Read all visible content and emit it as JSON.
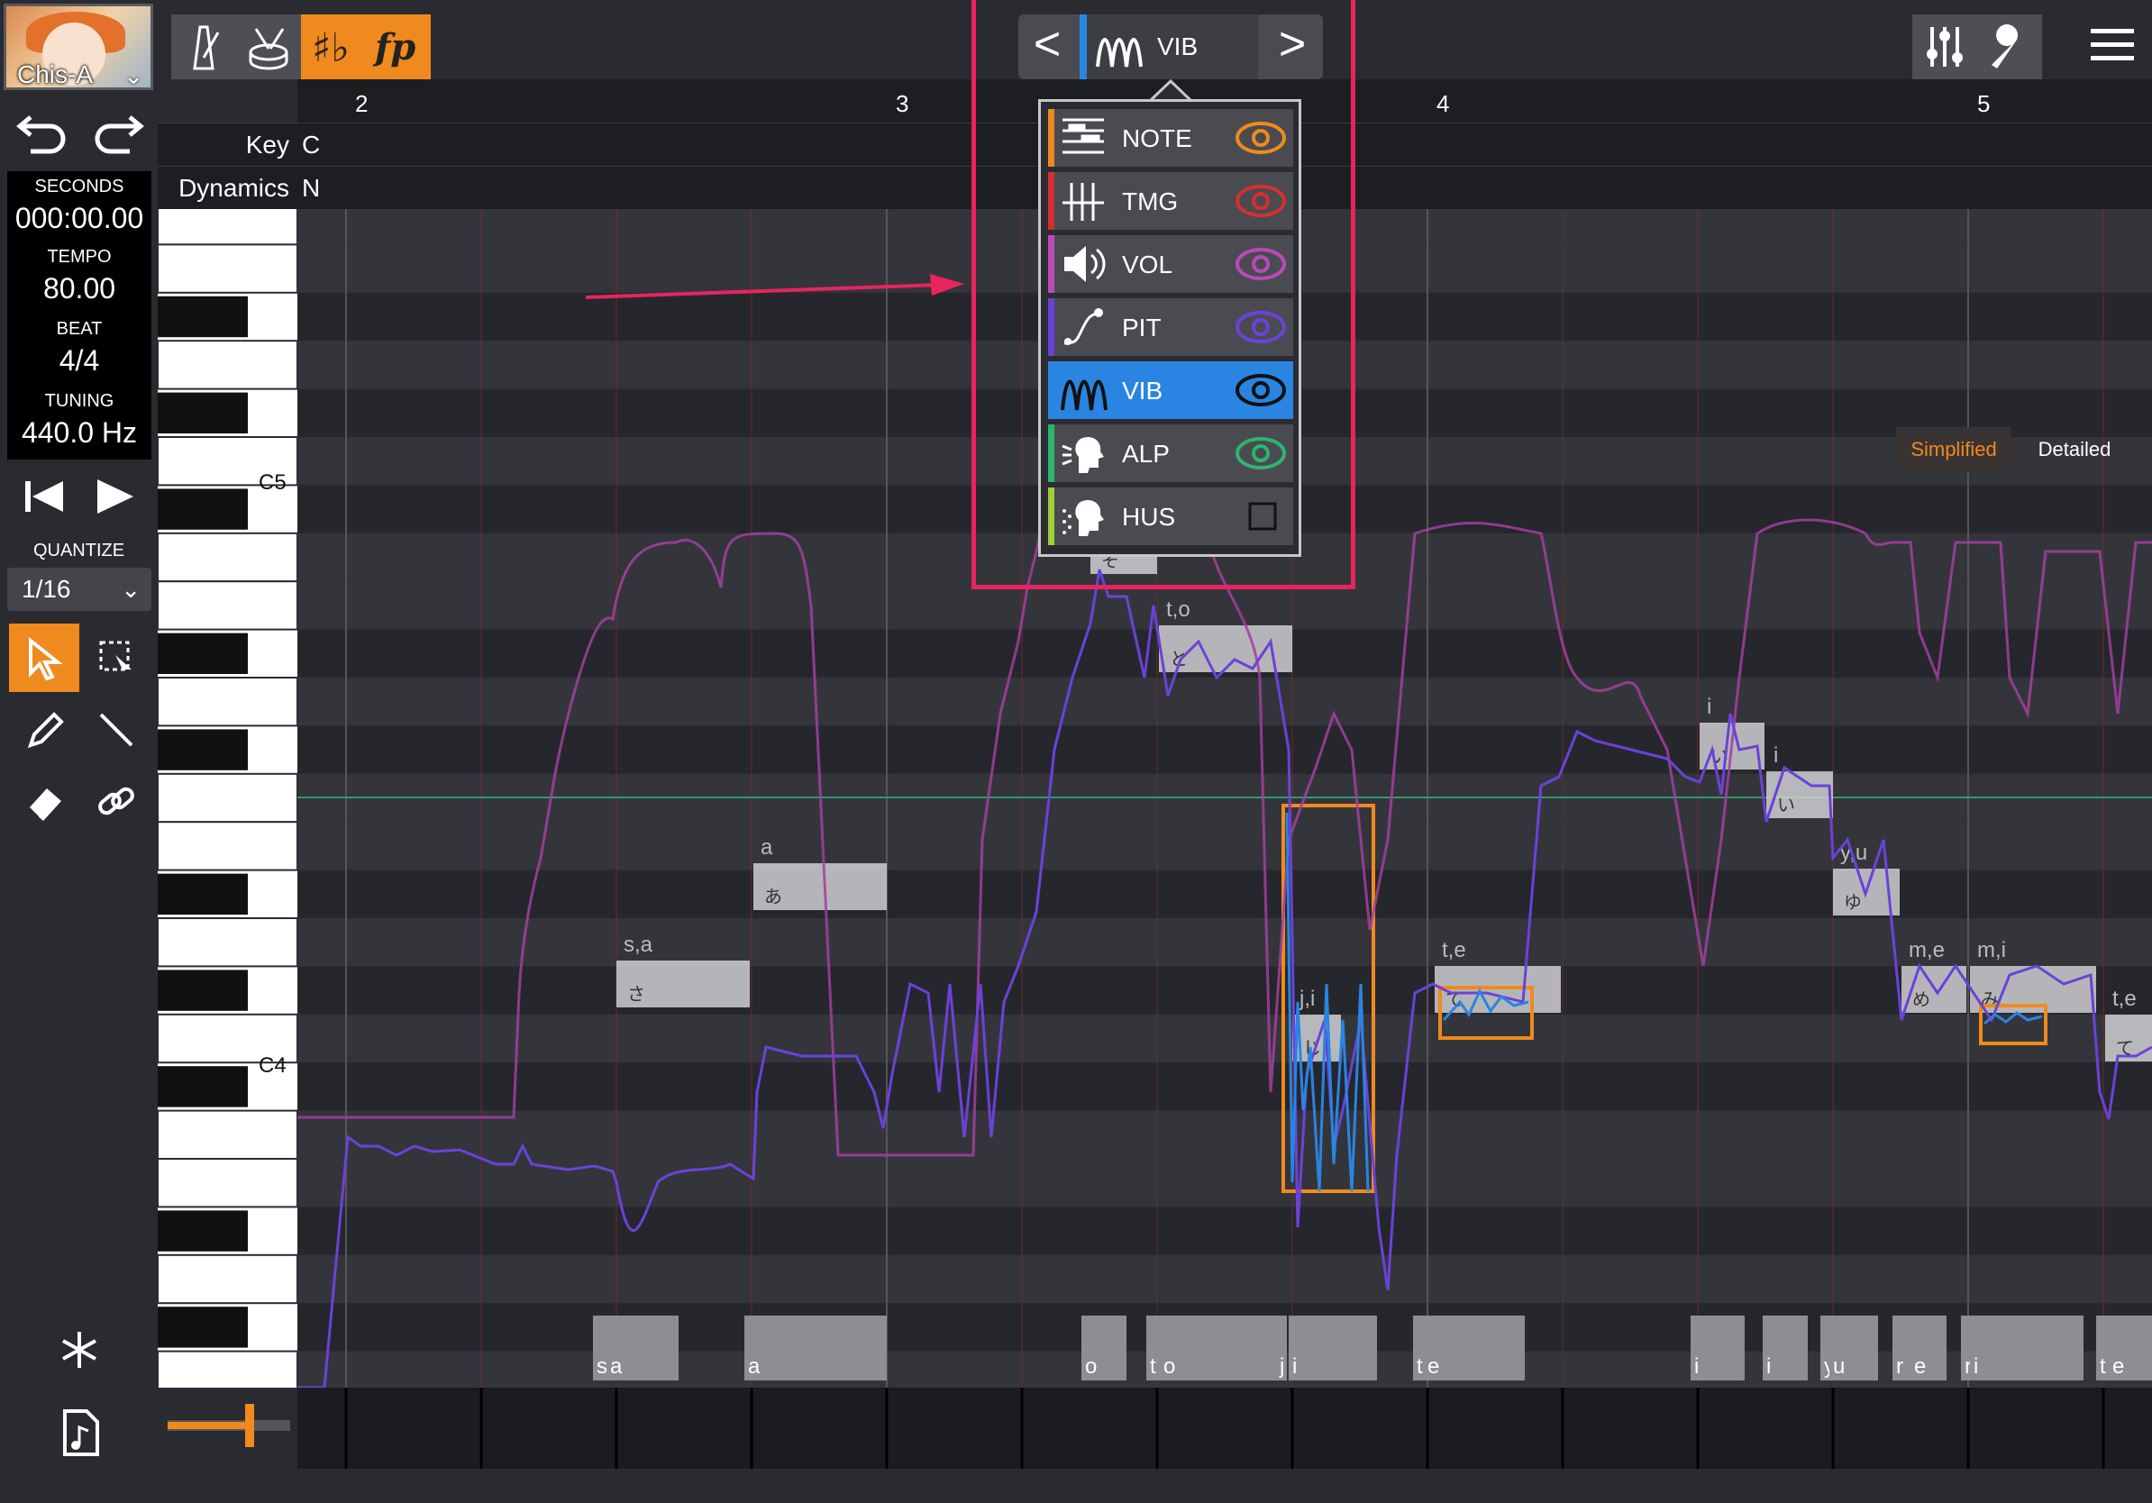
{
  "singer": {
    "name": "Chis-A"
  },
  "toolbar": {
    "left_icons": [
      "metronome-icon",
      "drum-icon",
      "sharp-flat-icon",
      "dynamics-fp-icon"
    ]
  },
  "selector": {
    "prev": "<",
    "label": "VIB",
    "next": ">"
  },
  "ruler": {
    "bars": [
      "2",
      "3",
      "4",
      "5"
    ]
  },
  "key_row": {
    "label": "Key",
    "value": "C"
  },
  "dynamics_row": {
    "label": "Dynamics",
    "value": "N"
  },
  "transport": {
    "seconds_label": "SECONDS",
    "seconds": "000:00.00",
    "tempo_label": "TEMPO",
    "tempo": "80.00",
    "beat_label": "BEAT",
    "beat": "4/4",
    "tuning_label": "TUNING",
    "tuning": "440.0 Hz"
  },
  "quantize": {
    "label": "QUANTIZE",
    "value": "1/16"
  },
  "piano": {
    "c5": "C5",
    "c4": "C4"
  },
  "view_toggle": {
    "simplified": "Simplified",
    "detailed": "Detailed"
  },
  "parameter_menu": [
    {
      "label": "NOTE",
      "color": "#ef8a1e",
      "visible": true
    },
    {
      "label": "TMG",
      "color": "#d23030",
      "visible": true
    },
    {
      "label": "VOL",
      "color": "#b94ab8",
      "visible": true
    },
    {
      "label": "PIT",
      "color": "#6b42d8",
      "visible": true
    },
    {
      "label": "VIB",
      "color": "#2a84e2",
      "visible": true,
      "selected": true
    },
    {
      "label": "ALP",
      "color": "#2fb36e",
      "visible": true
    },
    {
      "label": "HUS",
      "color": "#9fd036",
      "visible": false
    }
  ],
  "notes": [
    {
      "phoneme": "s,a",
      "lyric": "さ"
    },
    {
      "phoneme": "a",
      "lyric": "あ"
    },
    {
      "phoneme": "",
      "lyric": "そ"
    },
    {
      "phoneme": "t,o",
      "lyric": "と"
    },
    {
      "phoneme": "j,i",
      "lyric": "じ"
    },
    {
      "phoneme": "t,e",
      "lyric": "て"
    },
    {
      "phoneme": "i",
      "lyric": "い"
    },
    {
      "phoneme": "i",
      "lyric": "い"
    },
    {
      "phoneme": "y,u",
      "lyric": "ゆ"
    },
    {
      "phoneme": "m,e",
      "lyric": "め"
    },
    {
      "phoneme": "m,i",
      "lyric": "み"
    },
    {
      "phoneme": "t,e",
      "lyric": "て"
    }
  ],
  "timing_blocks": [
    {
      "text": "s"
    },
    {
      "text": "a"
    },
    {
      "text": "a"
    },
    {
      "text": "o"
    },
    {
      "text": "t"
    },
    {
      "text": "o"
    },
    {
      "text": "j"
    },
    {
      "text": "i"
    },
    {
      "text": "t"
    },
    {
      "text": "e"
    },
    {
      "text": "i"
    },
    {
      "text": "i"
    },
    {
      "text": "y"
    },
    {
      "text": "u"
    },
    {
      "text": "r"
    },
    {
      "text": "e"
    },
    {
      "text": "r"
    },
    {
      "text": "i"
    },
    {
      "text": "t"
    },
    {
      "text": "e"
    }
  ],
  "annotation": {
    "highlight_color": "#e8245e",
    "vibrato_box_color": "#ef8a1e"
  }
}
